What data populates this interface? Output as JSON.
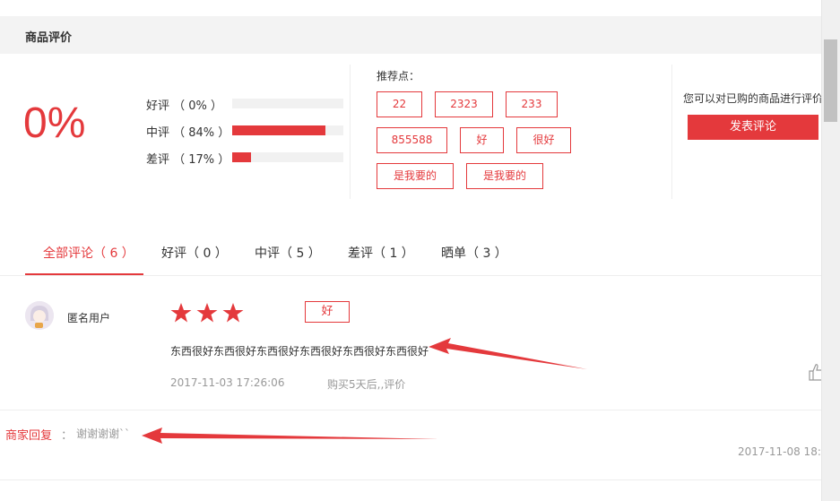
{
  "section": {
    "title": "商品评价"
  },
  "rating": {
    "overall": "0%",
    "rows": [
      {
        "label": "好评 （ 0% ）",
        "percent": 0
      },
      {
        "label": "中评 （ 84% ）",
        "percent": 84
      },
      {
        "label": "差评 （ 17% ）",
        "percent": 17
      }
    ]
  },
  "recommend": {
    "title": "推荐点：",
    "tags": [
      "22",
      "2323",
      "233",
      "855588",
      "好",
      "很好",
      "是我要的",
      "是我要的"
    ]
  },
  "side": {
    "note": "您可以对已购的商品进行评价",
    "post_button": "发表评论"
  },
  "tabs": [
    {
      "label": "全部评论（ 6 ）",
      "active": true
    },
    {
      "label": "好评（ 0 ）",
      "active": false
    },
    {
      "label": "中评（ 5 ）",
      "active": false
    },
    {
      "label": "差评（ 1 ）",
      "active": false
    },
    {
      "label": "晒单（ 3 ）",
      "active": false
    }
  ],
  "comment": {
    "username": "匿名用户",
    "stars": 3,
    "tag": "好",
    "text": "东西很好东西很好东西很好东西很好东西很好东西很好",
    "date": "2017-11-03 17:26:06",
    "after_purchase": "购买5天后,,评价"
  },
  "reply": {
    "label": "商家回复",
    "colon": "：",
    "text": "谢谢谢谢``",
    "date": "2017-11-08 18:"
  },
  "colors": {
    "accent": "#e4393c",
    "muted": "#999999"
  },
  "icons": [
    "star-icon",
    "thumbs-up-icon",
    "avatar"
  ]
}
